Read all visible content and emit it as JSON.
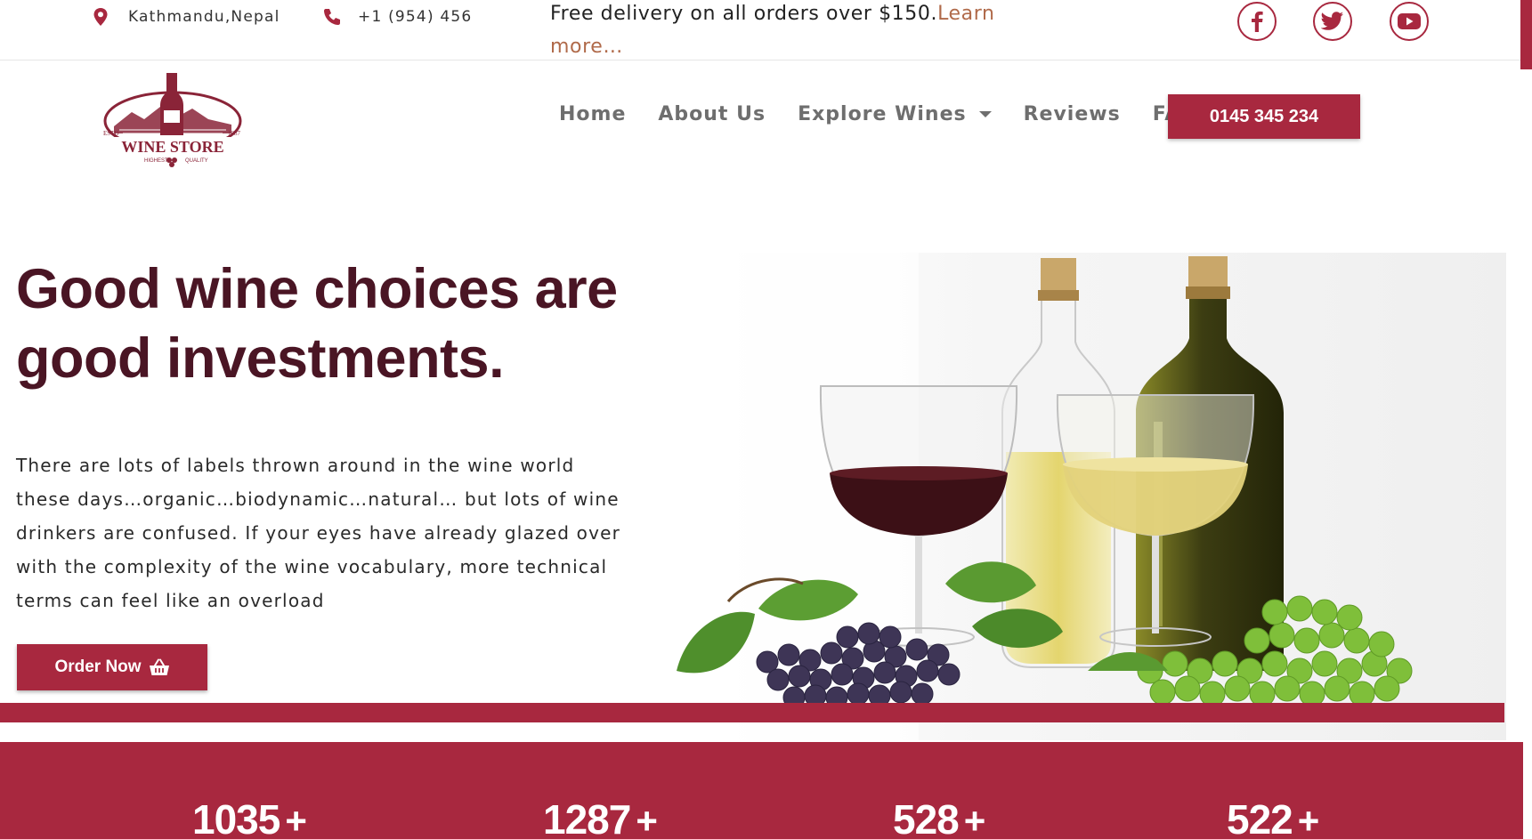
{
  "topbar": {
    "location_icon": "map-pin-icon",
    "location": "Kathmandu,Nepal",
    "phone_icon": "phone-icon",
    "phone": "+1 (954) 456",
    "promo_text": "Free delivery on all orders over $150.",
    "promo_link": "Learn more…",
    "social": [
      {
        "icon": "facebook-icon"
      },
      {
        "icon": "twitter-icon"
      },
      {
        "icon": "youtube-icon"
      }
    ]
  },
  "logo": {
    "name": "WINE STORE",
    "tagline_left": "HIGHEST",
    "tagline_right": "QUALITY",
    "estd": "ESTD",
    "year": "1987"
  },
  "nav": {
    "items": [
      {
        "label": "Home"
      },
      {
        "label": "About Us"
      },
      {
        "label": "Explore Wines"
      },
      {
        "label": "Reviews"
      },
      {
        "label": "FAQ"
      }
    ],
    "cta_label": "0145 345 234"
  },
  "hero": {
    "title": "Good wine choices are good investments.",
    "body": "There are lots of labels thrown around in the wine world these days…organic…biodynamic…natural… but lots of wine drinkers are confused. If your eyes have already glazed over with the complexity of the wine vocabulary, more technical terms can feel like an overload",
    "button_label": "Order Now",
    "button_icon": "basket-icon"
  },
  "stats": [
    {
      "value": "1035",
      "suffix": "+"
    },
    {
      "value": "1287",
      "suffix": "+"
    },
    {
      "value": "528",
      "suffix": "+"
    },
    {
      "value": "522",
      "suffix": "+"
    }
  ],
  "colors": {
    "brand": "#a8283f",
    "heading": "#4a1524",
    "nav_text": "#6e6e6e",
    "promo_link": "#b06a4a"
  }
}
